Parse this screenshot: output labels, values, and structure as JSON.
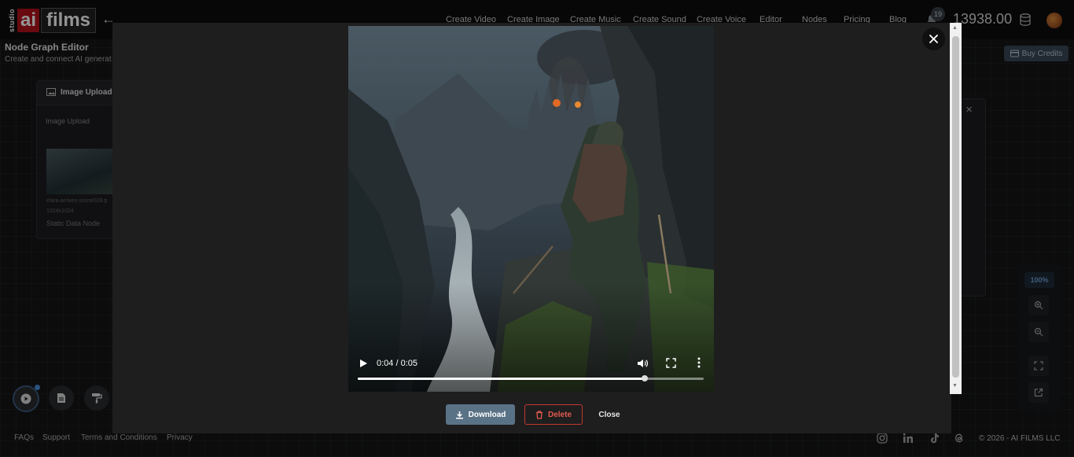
{
  "header": {
    "logo_studio": "studio",
    "logo_ai": "ai",
    "logo_films": "films",
    "nav": [
      "Create Video",
      "Create Image",
      "Create Music",
      "Create Sound",
      "Create Voice",
      "Editor",
      "Nodes",
      "Pricing",
      "Blog"
    ],
    "notifications_count": "19",
    "credits": "13938.00"
  },
  "page": {
    "title": "Node Graph Editor",
    "subtitle": "Create and connect AI generat",
    "buy_credits": "Buy Credits"
  },
  "node": {
    "title": "Image Upload",
    "label": "Image Upload",
    "filename": "elara-arrives-scene028.p",
    "dimensions": "1024x1024",
    "type": "Static Data Node"
  },
  "zoom": {
    "level": "100%"
  },
  "modal": {
    "video_time": "0:04 / 0:05",
    "progress": 0.83,
    "download_label": "Download",
    "delete_label": "Delete",
    "close_label": "Close"
  },
  "footer": {
    "links": [
      "FAQs",
      "Support",
      "Terms and Conditions",
      "Privacy"
    ],
    "copyright": "© 2026 - AI FILMS LLC"
  },
  "colors": {
    "accent": "#5a7286",
    "danger": "#e25a4c",
    "zoom_text": "#6fa0d8",
    "brand_red": "#b3121a"
  }
}
